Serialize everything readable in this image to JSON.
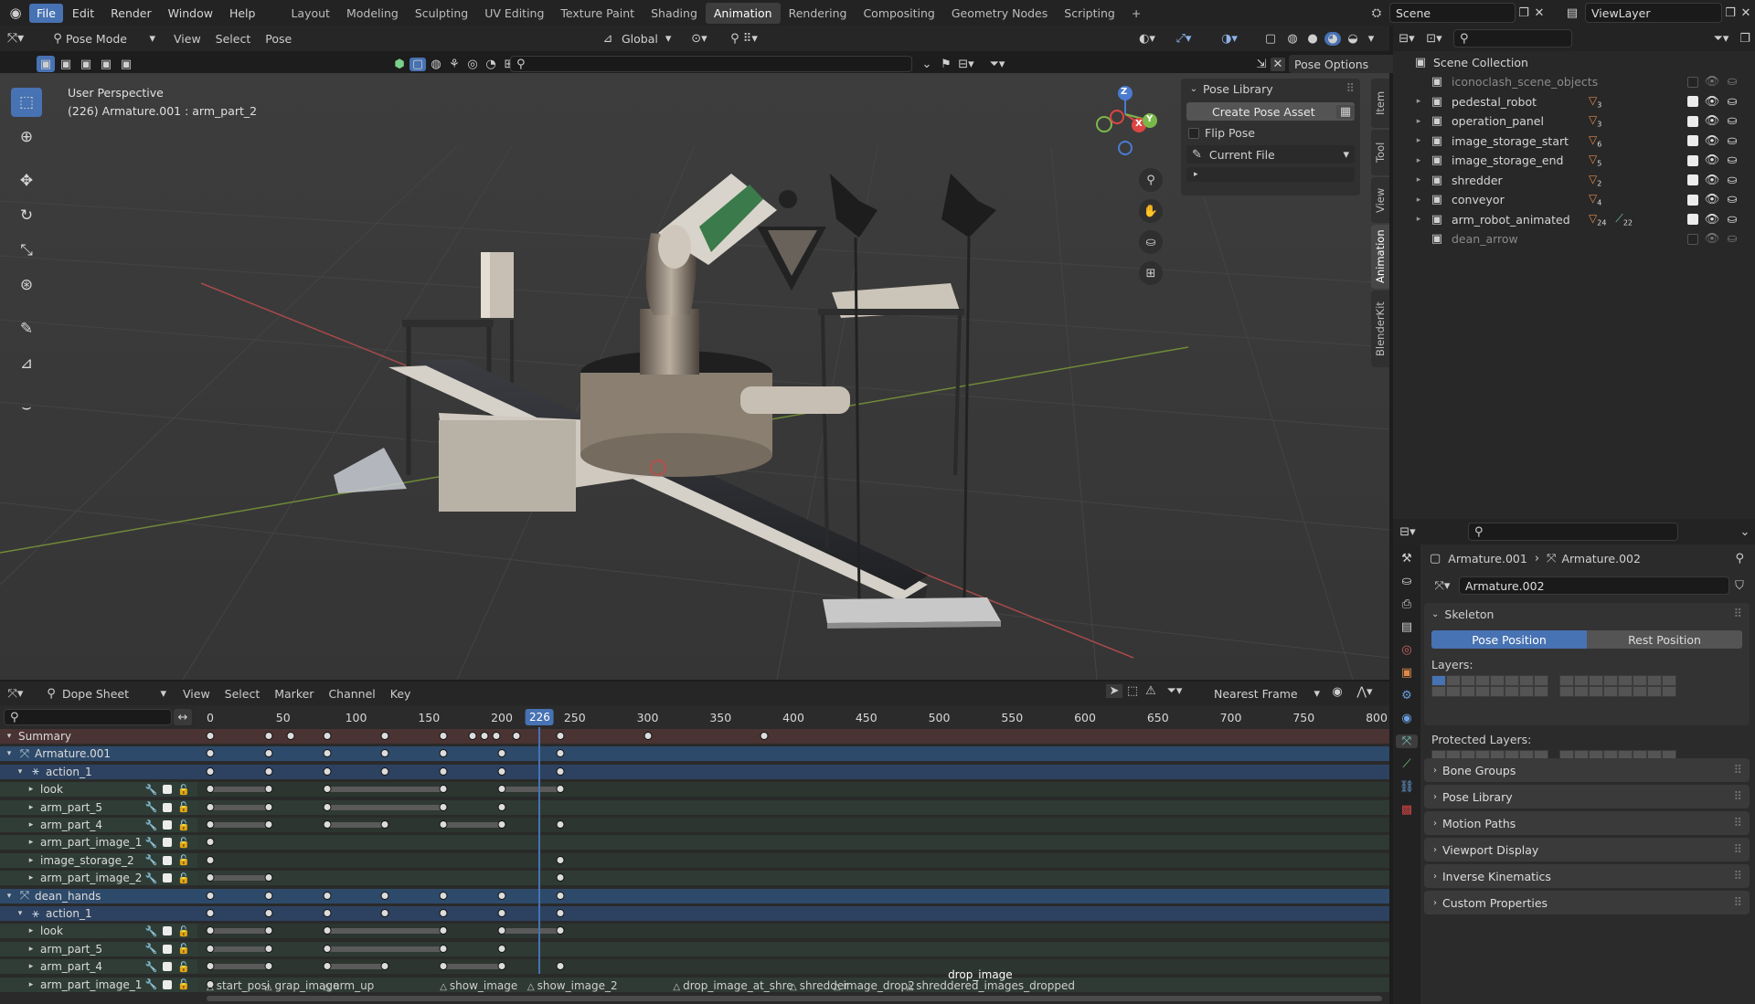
{
  "topbar": {
    "menus": [
      "File",
      "Edit",
      "Render",
      "Window",
      "Help"
    ],
    "workspaces": [
      "Layout",
      "Modeling",
      "Sculpting",
      "UV Editing",
      "Texture Paint",
      "Shading",
      "Animation",
      "Rendering",
      "Compositing",
      "Geometry Nodes",
      "Scripting"
    ],
    "active_workspace": "Animation",
    "add_tab": "+",
    "scene": "Scene",
    "view_layer": "ViewLayer"
  },
  "viewport_header": {
    "mode": "Pose Mode",
    "menus": [
      "View",
      "Select",
      "Pose"
    ],
    "transform_orientation": "Global",
    "pose_options": "Pose Options"
  },
  "viewport": {
    "perspective": "User Perspective",
    "object_info": "(226) Armature.001 : arm_part_2",
    "gizmo_axes": {
      "z": "Z",
      "x": "X",
      "y": "Y"
    }
  },
  "sidebar": {
    "panel_title": "Pose Library",
    "create_button": "Create Pose Asset",
    "flip_pose": "Flip Pose",
    "library_select": "Current File",
    "tabs": [
      "Item",
      "Tool",
      "View",
      "Animation",
      "BlenderKit"
    ],
    "active_tab": "Animation"
  },
  "outliner": {
    "root": "Scene Collection",
    "items": [
      {
        "name": "iconoclash_scene_objects",
        "badge": "",
        "visible": false
      },
      {
        "name": "pedestal_robot",
        "badge": "3",
        "visible": true
      },
      {
        "name": "operation_panel",
        "badge": "3",
        "visible": true
      },
      {
        "name": "image_storage_start",
        "badge": "6",
        "visible": true
      },
      {
        "name": "image_storage_end",
        "badge": "5",
        "visible": true
      },
      {
        "name": "shredder",
        "badge": "2",
        "visible": true
      },
      {
        "name": "conveyor",
        "badge": "4",
        "visible": true
      },
      {
        "name": "arm_robot_animated",
        "badge": "24",
        "badge2": "22",
        "visible": true
      },
      {
        "name": "dean_arrow",
        "badge": "",
        "visible": false
      }
    ]
  },
  "properties": {
    "breadcrumb_a": "Armature.001",
    "breadcrumb_b": "Armature.002",
    "datablock": "Armature.002",
    "skeleton": "Skeleton",
    "pose_position": "Pose Position",
    "rest_position": "Rest Position",
    "layers": "Layers:",
    "protected_layers": "Protected Layers:",
    "panels": [
      "Bone Groups",
      "Pose Library",
      "Motion Paths",
      "Viewport Display",
      "Inverse Kinematics",
      "Custom Properties"
    ]
  },
  "dopesheet": {
    "editor": "Dope Sheet",
    "menus": [
      "View",
      "Select",
      "Marker",
      "Channel",
      "Key"
    ],
    "snap": "Nearest Frame",
    "current_frame": "226",
    "ticks": [
      "0",
      "50",
      "100",
      "150",
      "200",
      "250",
      "300",
      "350",
      "400",
      "450",
      "500",
      "550",
      "600",
      "650",
      "700",
      "750",
      "800"
    ],
    "channels": [
      {
        "name": "Summary",
        "type": "summary",
        "indent": 0
      },
      {
        "name": "Armature.001",
        "type": "object",
        "indent": 0
      },
      {
        "name": "action_1",
        "type": "action",
        "indent": 1
      },
      {
        "name": "look",
        "type": "group",
        "indent": 2
      },
      {
        "name": "arm_part_5",
        "type": "group",
        "indent": 2
      },
      {
        "name": "arm_part_4",
        "type": "group",
        "indent": 2
      },
      {
        "name": "arm_part_image_1",
        "type": "group",
        "indent": 2
      },
      {
        "name": "image_storage_2",
        "type": "group",
        "indent": 2
      },
      {
        "name": "arm_part_image_2",
        "type": "group",
        "indent": 2
      },
      {
        "name": "dean_hands",
        "type": "object",
        "indent": 0
      },
      {
        "name": "action_1",
        "type": "action",
        "indent": 1
      },
      {
        "name": "look",
        "type": "group",
        "indent": 2
      },
      {
        "name": "arm_part_5",
        "type": "group",
        "indent": 2
      },
      {
        "name": "arm_part_4",
        "type": "group",
        "indent": 2
      },
      {
        "name": "arm_part_image_1",
        "type": "group",
        "indent": 2
      }
    ],
    "keyframes": [
      [
        0,
        40,
        55,
        80,
        120,
        160,
        180,
        188,
        196,
        210,
        240,
        300,
        380
      ],
      [
        0,
        40,
        80,
        120,
        160,
        200,
        240
      ],
      [
        0,
        40,
        80,
        120,
        160,
        200,
        240
      ],
      [
        0,
        40,
        80,
        160,
        200,
        240
      ],
      [
        0,
        40,
        80,
        160,
        200
      ],
      [
        0,
        40,
        80,
        120,
        160,
        200,
        240
      ],
      [
        0
      ],
      [
        0,
        240
      ],
      [
        0,
        40,
        240
      ],
      [
        0,
        40,
        80,
        120,
        160,
        200,
        240
      ],
      [
        0,
        40,
        80,
        120,
        160,
        200,
        240
      ],
      [
        0,
        40,
        80,
        160,
        200,
        240
      ],
      [
        0,
        40,
        80,
        160,
        200
      ],
      [
        0,
        40,
        80,
        120,
        160,
        200,
        240
      ],
      [
        0
      ]
    ],
    "markers": [
      {
        "frame": 0,
        "label": "start_posi"
      },
      {
        "frame": 40,
        "label": "grap_image"
      },
      {
        "frame": 80,
        "label": "arm_up"
      },
      {
        "frame": 160,
        "label": "show_image"
      },
      {
        "frame": 220,
        "label": "show_image_2"
      },
      {
        "frame": 320,
        "label": "drop_image_at_shre"
      },
      {
        "frame": 400,
        "label": "shredder"
      },
      {
        "frame": 430,
        "label": "image_drop2"
      },
      {
        "frame": 480,
        "label": "shreddered_images_dropped"
      }
    ],
    "marker_over": "drop_image"
  },
  "colors": {
    "accent": "#4772b3",
    "keyframe": "#dcdcdc",
    "playhead": "#4772b3",
    "summary_row": "#4a2f2f"
  }
}
